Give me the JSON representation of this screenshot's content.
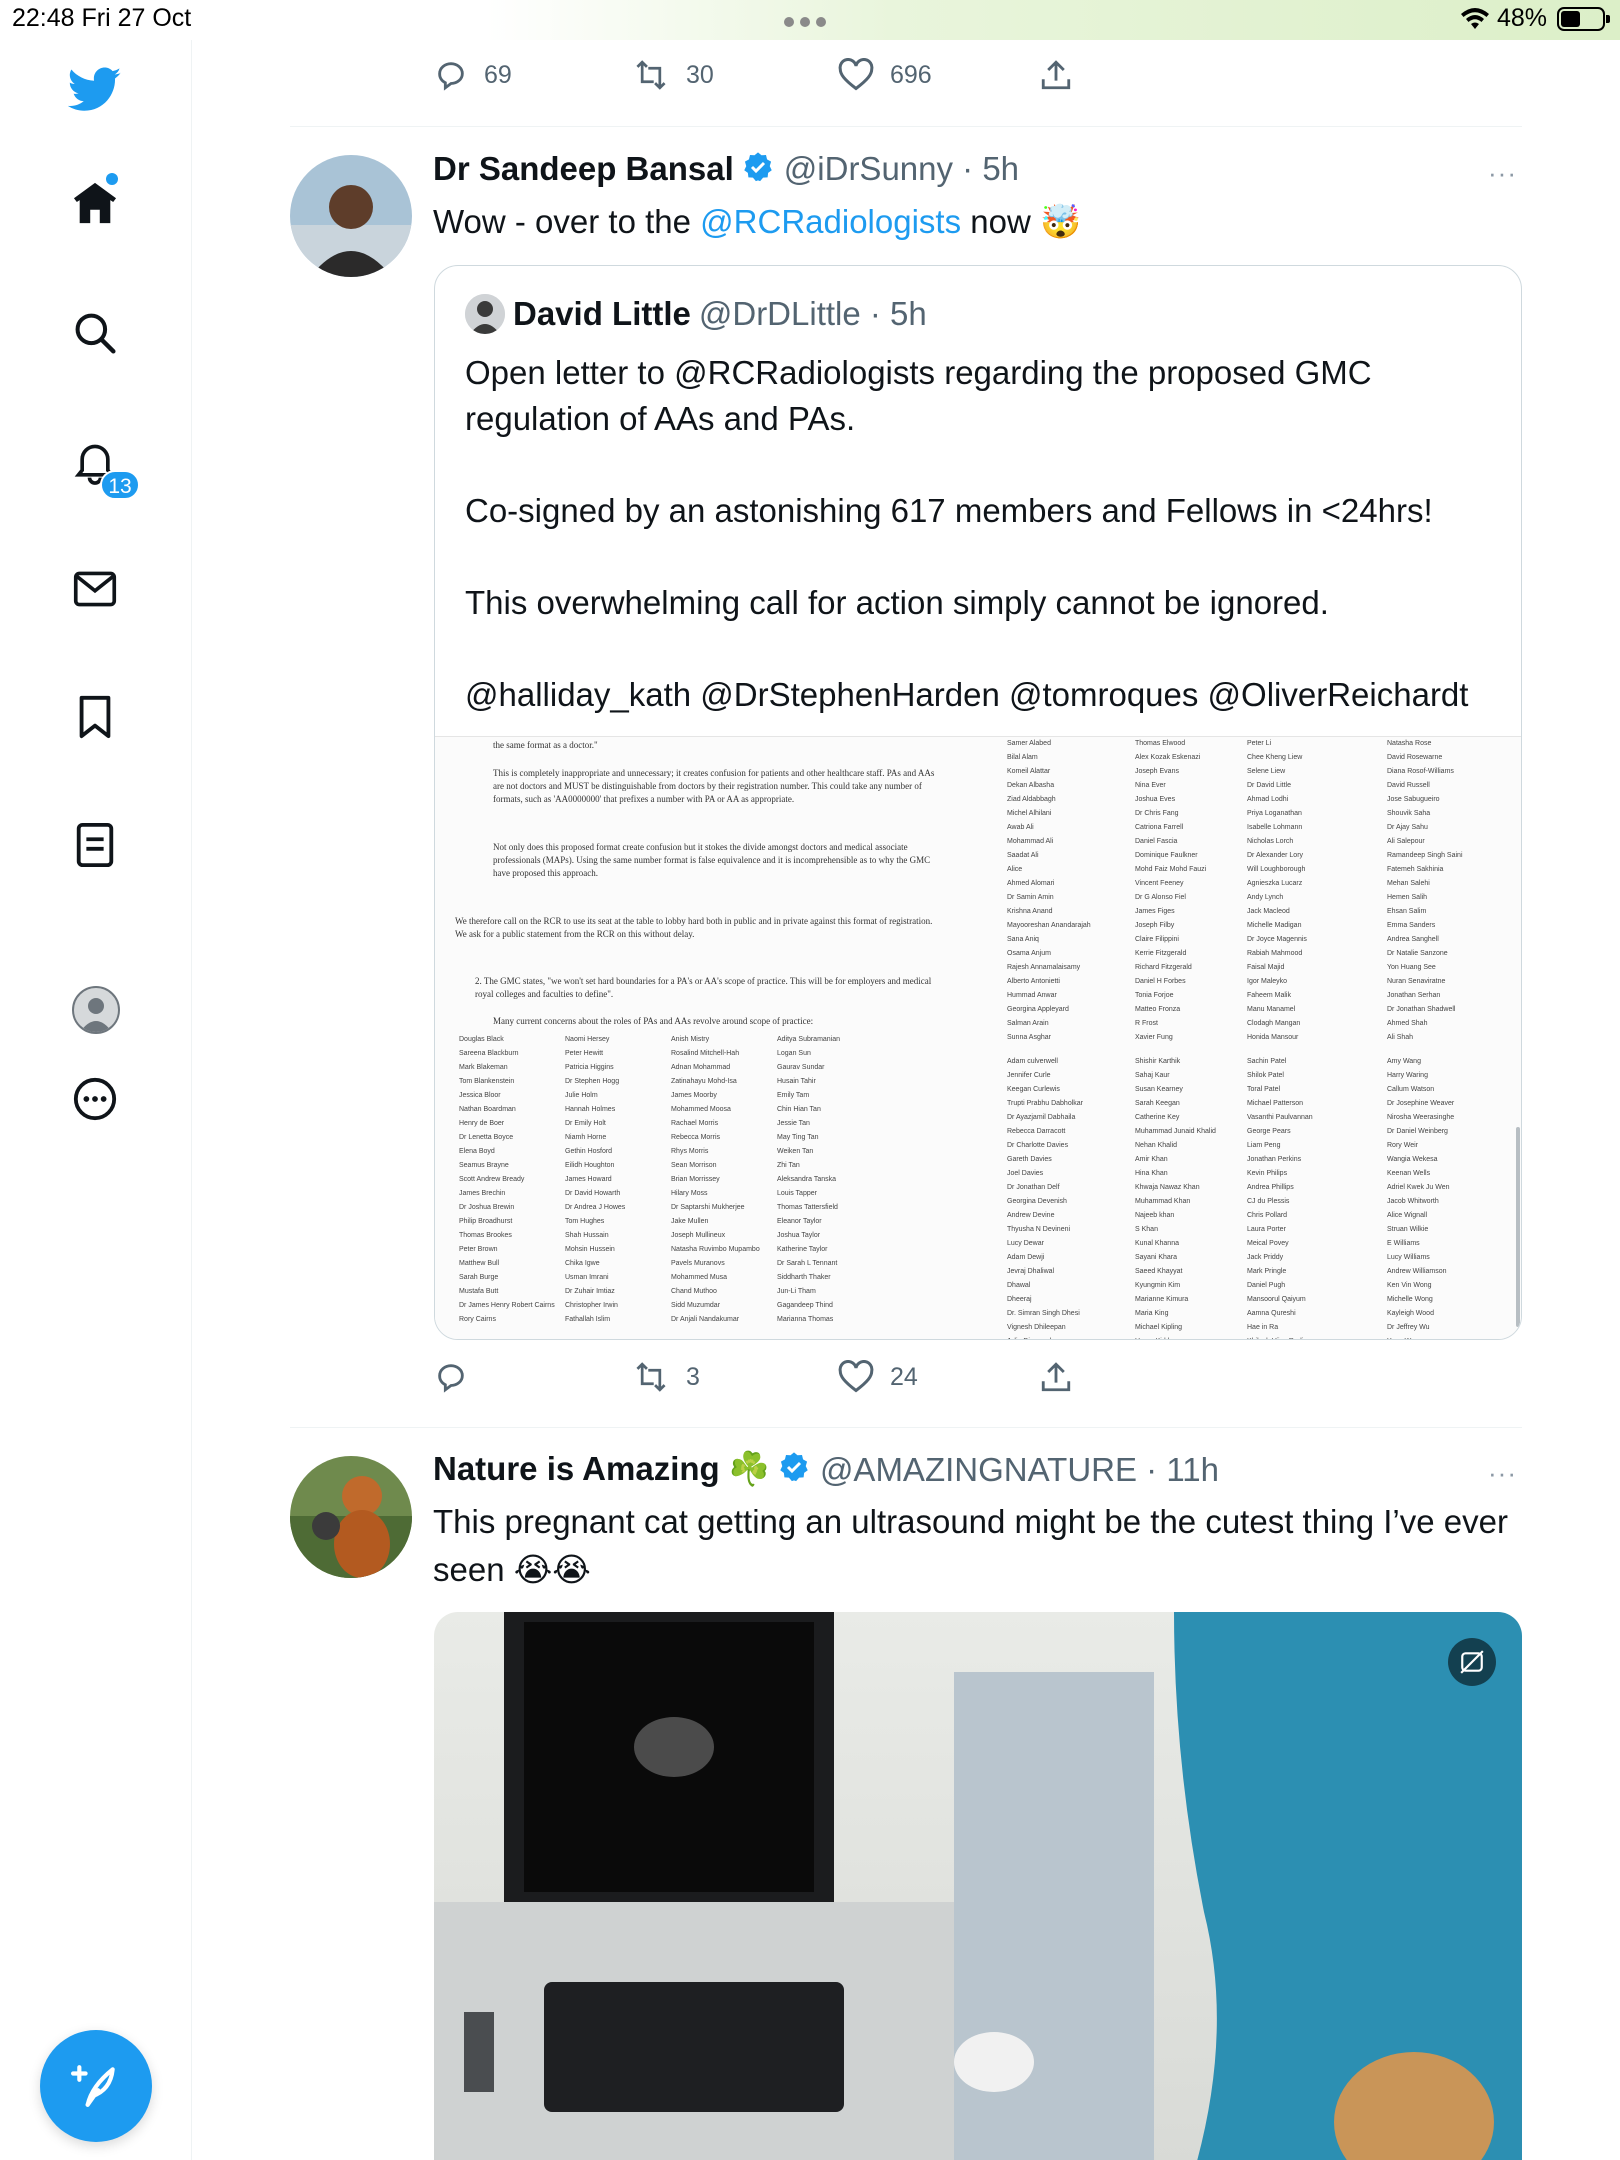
{
  "status_bar": {
    "time_date": "22:48  Fri 27 Oct",
    "battery": "48%",
    "battery_level": 0.48
  },
  "sidebar": {
    "items": [
      {
        "name": "twitter-logo-icon"
      },
      {
        "name": "home-icon"
      },
      {
        "name": "search-icon"
      },
      {
        "name": "notifications-icon",
        "badge": "13"
      },
      {
        "name": "messages-icon"
      },
      {
        "name": "bookmarks-icon"
      },
      {
        "name": "lists-icon"
      },
      {
        "name": "profile-icon"
      },
      {
        "name": "more-icon"
      }
    ],
    "compose_icon": "compose-icon"
  },
  "colors": {
    "accent": "#1d9bf0",
    "secondary_text": "#536471",
    "border": "#cfd9de"
  },
  "prev_tweet_actions": {
    "replies": "69",
    "retweets": "30",
    "likes": "696"
  },
  "tweet1": {
    "name": "Dr Sandeep Bansal",
    "handle": "@iDrSunny · 5h",
    "text_pre": "Wow - over to the ",
    "mention": "@RCRadiologists",
    "text_post": " now 🤯",
    "more": "···",
    "quote": {
      "name": "David Little",
      "handle": "@DrDLittle · 5h",
      "lines": [
        "Open letter to @RCRadiologists regarding the proposed GMC regulation of AAs and PAs.",
        "Co-signed by an astonishing 617 members and Fellows in <24hrs!",
        "This overwhelming call for action simply cannot be ignored.",
        "@halliday_kath @DrStephenHarden @tomroques @OliverReichardt"
      ],
      "doc": {
        "p0": "the same format as a doctor.\"",
        "p1": "This is completely inappropriate and unnecessary; it creates confusion for patients and other healthcare staff. PAs and AAs are not doctors and MUST be distinguishable from doctors by their registration number. This could take any number of formats, such as 'AA0000000' that prefixes a number with PA or AA as appropriate.",
        "p2": "Not only does this proposed format create confusion but it stokes the divide amongst doctors and medical associate professionals (MAPs). Using the same number format is false equivalence and it is incomprehensible as to why the GMC have proposed this approach.",
        "p3": "We therefore call on the RCR to use its seat at the table to lobby hard both in public and in private against this format of registration. We ask for a public statement from the RCR on this without delay.",
        "p4": "2.  The GMC states, \"we won't set hard boundaries for a PA's or AA's scope of practice. This will be for employers and medical royal colleges and faculties to define\".",
        "p5": "Many current concerns about the roles of PAs and AAs revolve around scope of practice:",
        "col1": [
          "Douglas Black",
          "Sareena Blackburn",
          "Mark Blakeman",
          "Tom Blankenstein",
          "Jessica Bloor",
          "Nathan Boardman",
          "Henry de Boer",
          "Dr Lenetta Boyce",
          "Elena Boyd",
          "Seamus Brayne",
          "Scott Andrew Bready",
          "James Brechin",
          "Dr Joshua Brewin",
          "Philip Broadhurst",
          "Thomas Brookes",
          "Peter Brown",
          "Matthew Bull",
          "Sarah Burge",
          "Mustafa Butt",
          "Dr James Henry Robert Cairns",
          "Rory Cairns"
        ],
        "col2": [
          "Naomi Hersey",
          "Peter Hewitt",
          "Patricia Higgins",
          "Dr Stephen Hogg",
          "Julie Holm",
          "Hannah Holmes",
          "Dr Emily Holt",
          "Niamh Horne",
          "Gethin Hosford",
          "Eilidh Houghton",
          "James Howard",
          "Dr David Howarth",
          "Dr Andrea J Howes",
          "Tom Hughes",
          "Shah Hussain",
          "Mohsin Hussein",
          "Chika Igwe",
          "Usman Imrani",
          "Dr Zuhair Imtiaz",
          "Christopher Irwin",
          "Fathallah Islim"
        ],
        "col3": [
          "Anish Mistry",
          "Rosalind Mitchell-Hah",
          "Adnan Mohammad",
          "Zatinahayu Mohd-Isa",
          "James Moorby",
          "Mohammed Moosa",
          "Rachael Morris",
          "Rebecca Morris",
          "Rhys Morris",
          "Sean Morrison",
          "Brian Morrissey",
          "Hilary Moss",
          "Dr Saptarshi Mukherjee",
          "Jake Mullen",
          "Joseph Mullineux",
          "Natasha Ruvimbo Mupambo",
          "Pavels Muranovs",
          "Mohammed Musa",
          "Chand Muthoo",
          "Sidd Muzumdar",
          "Dr Anjali Nandakumar"
        ],
        "col4": [
          "Aditya Subramanian",
          "Logan Sun",
          "Gaurav Sundar",
          "Husain Tahir",
          "Emily Tam",
          "Chin Hian Tan",
          "Jessie Tan",
          "May Ting Tan",
          "Weiken Tan",
          "Zhi Tan",
          "Aleksandra Tanska",
          "Louis Tapper",
          "Thomas Tattersfield",
          "Eleanor Taylor",
          "Joshua Taylor",
          "Katherine Taylor",
          "Dr Sarah L Tennant",
          "Siddharth Thaker",
          "Jun-Li Tham",
          "Gagandeep Thind",
          "Marianna Thomas"
        ],
        "col5": [
          "Samer Alabed",
          "Bilal Alam",
          "Komeil Alattar",
          "Dekan Albasha",
          "Ziad Aldabbagh",
          "Michel Alhilani",
          "Awab Ali",
          "Mohammad Ali",
          "Saadat Ali",
          "Alice",
          "Ahmed Alomari",
          "Dr Samin Amin",
          "Krishna Anand",
          "Mayooreshan Anandarajah",
          "Sana Aniq",
          "Osama Anjum",
          "Rajesh Annamalaisamy",
          "Alberto Antonietti",
          "Hummad Anwar",
          "Georgina Appleyard",
          "Salman Arain",
          "Sunna Asghar",
          "",
          "Adam culverwell",
          "Jennifer Curle",
          "Keegan Curlewis",
          "Trupti Prabhu Dabholkar",
          "Dr Ayazjamil Dabhaila",
          "Rebecca Darracott",
          "Dr Charlotte Davies",
          "Gareth Davies",
          "Joel Davies",
          "Dr Jonathan Delf",
          "Georgina Devenish",
          "Andrew Devine",
          "Thyusha N Devineni",
          "Lucy Dewar",
          "Adam Dewji",
          "Jevraj Dhaliwal",
          "Dhawal",
          "Dheeraj",
          "Dr. Simran Singh Dhesi",
          "Vignesh Dhileepan",
          "Julia Diamond"
        ],
        "col6": [
          "Thomas Elwood",
          "Alex Kozak Eskenazi",
          "Joseph Evans",
          "Nina Ever",
          "Joshua Eves",
          "Dr Chris Fang",
          "Catriona Farrell",
          "Daniel Fascia",
          "Dominique Faulkner",
          "Mohd Faiz Mohd Fauzi",
          "Vincent Feeney",
          "Dr G Alonso Fiel",
          "James Figes",
          "Joseph Filby",
          "Claire Filippini",
          "Kerrie Fitzgerald",
          "Richard Fitzgerald",
          "Daniel H Forbes",
          "Tonia Forjoe",
          "Matteo Fronza",
          "R Frost",
          "Xavier Fung",
          "",
          "Shishir Karthik",
          "Sahaj Kaur",
          "Susan Kearney",
          "Sarah Keegan",
          "Catherine Key",
          "Muhammad Junaid Khalid",
          "Nehan Khalid",
          "Amir Khan",
          "Hina Khan",
          "Khwaja Nawaz Khan",
          "Muhammad Khan",
          "Najeeb khan",
          "S Khan",
          "Kunal Khanna",
          "Sayani Khara",
          "Saeed Khayyat",
          "Kyungmin Kim",
          "Marianne Kimura",
          "Maria King",
          "Michael Kipling",
          "Henry Kirkham"
        ],
        "col7": [
          "Peter Li",
          "Chee Kheng Liew",
          "Selene Liew",
          "Dr David Little",
          "Ahmad Lodhi",
          "Priya Loganathan",
          "Isabelle Lohmann",
          "Nicholas Lorch",
          "Dr Alexander Lory",
          "Will Loughborough",
          "Agnieszka Lucarz",
          "Andy Lynch",
          "Jack Macleod",
          "Michelle Madigan",
          "Dr Joyce Magennis",
          "Rabiah Mahmood",
          "Faisal Majid",
          "Igor Maleyko",
          "Faheem Malik",
          "Manu Manamel",
          "Clodagh Mangan",
          "Honida Mansour",
          "",
          "Sachin Patel",
          "Shilok Patel",
          "Toral Patel",
          "Michael Patterson",
          "Vasanthi Paulvannan",
          "George Pears",
          "Liam Peng",
          "Jonathan Perkins",
          "Kevin Philips",
          "Andrea Phillips",
          "CJ du Plessis",
          "Chris Pollard",
          "Laura Porter",
          "Meical Povey",
          "Jack Priddy",
          "Mark Pringle",
          "Daniel Pugh",
          "Mansoorul Qaiyum",
          "Aamna Qureshi",
          "Hae in Ra",
          "Khilesh Vijay Radia"
        ],
        "col8": [
          "Natasha Rose",
          "David Rosewarne",
          "Diana Rosof-Williams",
          "David Russell",
          "Jose Sabugueiro",
          "Shouvik Saha",
          "Dr Ajay Sahu",
          "Ali Salepour",
          "Ramandeep Singh Saini",
          "Fatemeh Sakhinia",
          "Mehan Salehi",
          "Hemen Salih",
          "Ehsan Salim",
          "Emma Sanders",
          "Andrea Sanghell",
          "Dr Natalie Sanzone",
          "Yon Huang See",
          "Nuran Senaviratne",
          "Jonathan Serhan",
          "Dr Jonathan Shadwell",
          "Ahmed Shah",
          "Ali Shah",
          "",
          "Amy Wang",
          "Harry Waring",
          "Callum Watson",
          "Dr Josephine Weaver",
          "Nirosha Weerasinghe",
          "Dr Daniel Weinberg",
          "Rory Weir",
          "Wangia Wekesa",
          "Keenan Wells",
          "Adriel Kwek Ju Wen",
          "Jacob Whitworth",
          "Alice Wignall",
          "Struan Wilkie",
          "E Williams",
          "Lucy Williams",
          "Andrew Williamson",
          "Ken Vin Wong",
          "Michelle Wong",
          "Kayleigh Wood",
          "Dr Jeffrey Wu",
          "Yong Wu"
        ]
      }
    },
    "actions": {
      "replies": "",
      "retweets": "3",
      "likes": "24"
    }
  },
  "tweet2": {
    "name": "Nature is Amazing ☘️",
    "handle": "@AMAZINGNATURE · 11h",
    "text": "This pregnant cat getting an ultrasound might be the cutest thing I’ve ever seen 😭😭",
    "more": "···"
  }
}
